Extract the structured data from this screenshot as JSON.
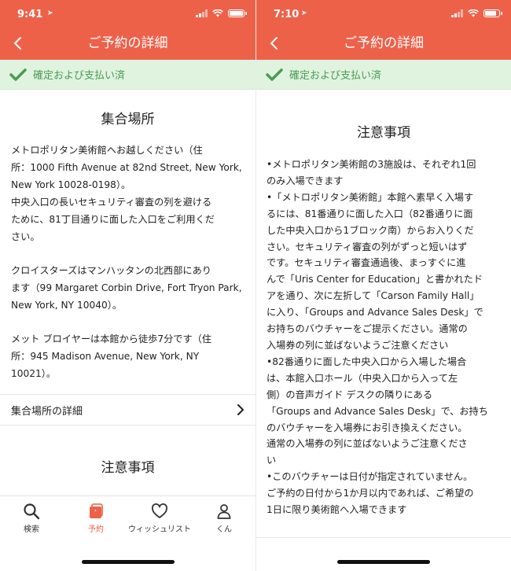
{
  "left": {
    "status": {
      "time": "9:41"
    },
    "nav_title": "ご予約の詳細",
    "banner_text": "確定および支払い済",
    "meeting_title": "集合場所",
    "meeting_paragraphs": [
      [
        "メトロポリタン美術館へお越しください（住",
        "所：1000 Fifth Avenue at 82nd Street, New York,",
        "New York 10028-0198）。",
        "中央入口の長いセキュリティ審査の列を避ける",
        "ために、81丁目通りに面した入口をご利用くだ",
        "さい。"
      ],
      [
        "クロイスターズはマンハッタンの北西部にあり",
        "ます（99 Margaret Corbin Drive, Fort Tryon Park,",
        "New York, NY 10040）。"
      ],
      [
        "メット ブロイヤーは本館から徒歩7分です（住",
        "所：945 Madison Avenue, New York, NY",
        "10021）。"
      ]
    ],
    "detail_link": "集合場所の詳細",
    "notes_title": "注意事項",
    "tabs": {
      "search": "検索",
      "booking": "予約",
      "wishlist": "ウィッシュリスト",
      "account": "くん"
    }
  },
  "right": {
    "status": {
      "time": "7:10"
    },
    "nav_title": "ご予約の詳細",
    "banner_text": "確定および支払い済",
    "notes_title": "注意事項",
    "notes_lines": [
      "•メトロポリタン美術館の3施設は、それぞれ1回",
      "のみ入場できます",
      "•「メトロポリタン美術館」本館へ素早く入場す",
      "るには、81番通りに面した入口（82番通りに面",
      "した中央入口から1ブロック南）からお入りくだ",
      "さい。セキュリティ審査の列がずっと短いはず",
      "です。セキュリティ審査通過後、まっすぐに進",
      "んで「Uris Center for Education」と書かれたド",
      "アを通り、次に左折して「Carson Family Hall」",
      "に入り、「Groups and Advance Sales Desk」で",
      "お持ちのバウチャーをご提示ください。通常の",
      "入場券の列に並ばないようご注意ください",
      "•82番通りに面した中央入口から入場した場合",
      "は、本館入口ホール（中央入口から入って左",
      "側）の音声ガイド デスクの隣りにある",
      "「Groups and Advance Sales Desk」で、お持ち",
      "のバウチャーを入場券にお引き換えください。",
      "通常の入場券の列に並ばないようご注意くださ",
      "い",
      "•このバウチャーは日付が指定されていません。",
      "ご予約の日付から1か月以内であれば、ご希望の",
      "1日に限り美術館へ入場できます"
    ]
  },
  "colors": {
    "accent": "#ee6149",
    "banner_bg": "#dff3df",
    "banner_text": "#4d9a55"
  }
}
